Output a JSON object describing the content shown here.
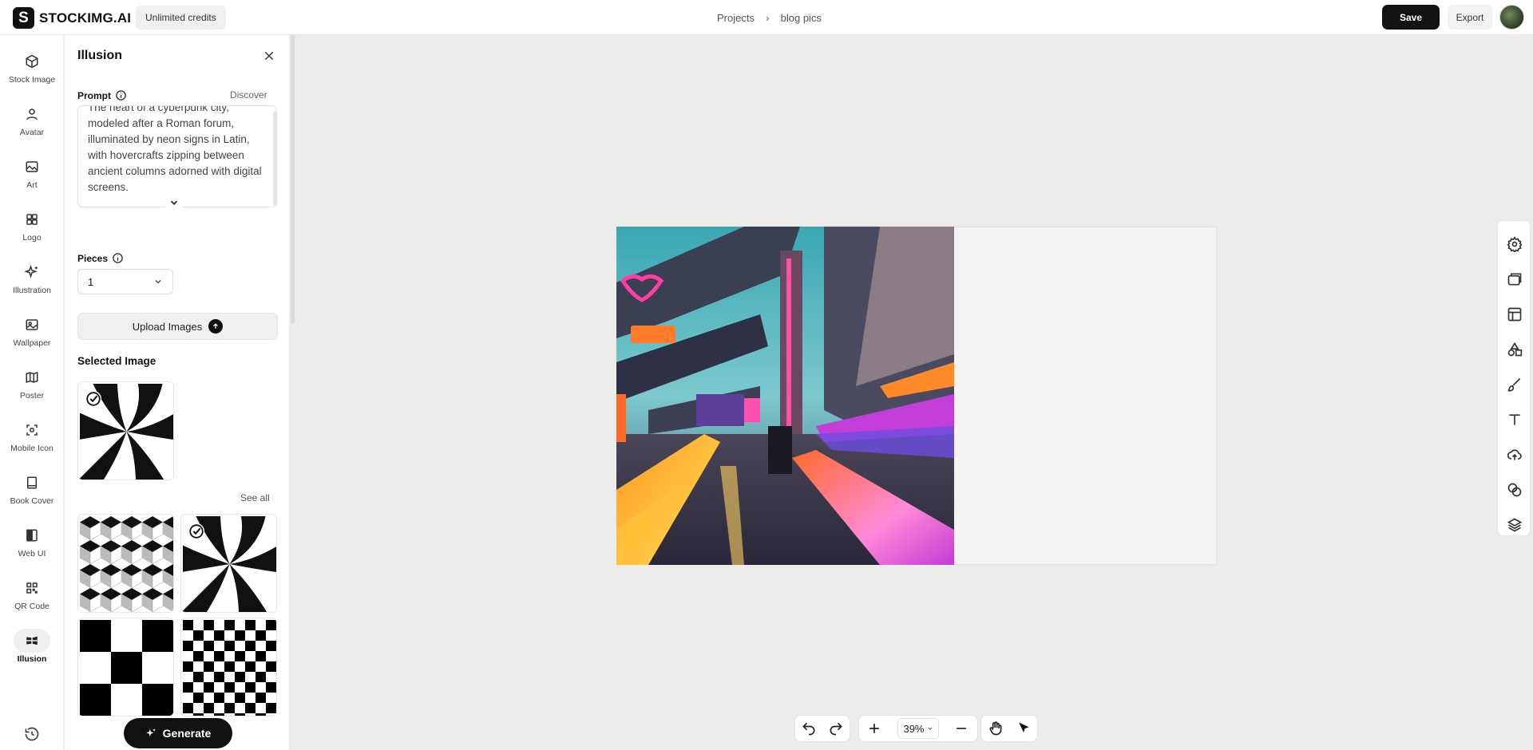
{
  "header": {
    "brand": "STOCKIMG.AI",
    "logo_letter": "S",
    "credits_label": "Unlimited credits",
    "breadcrumb": [
      "Projects",
      "blog pics"
    ],
    "save_label": "Save",
    "export_label": "Export"
  },
  "rail": {
    "items": [
      {
        "label": "Stock Image",
        "icon": "cube-icon"
      },
      {
        "label": "Avatar",
        "icon": "person-icon"
      },
      {
        "label": "Art",
        "icon": "image-icon"
      },
      {
        "label": "Logo",
        "icon": "grid-icon"
      },
      {
        "label": "Illustration",
        "icon": "sparkle-icon"
      },
      {
        "label": "Wallpaper",
        "icon": "picture-icon"
      },
      {
        "label": "Poster",
        "icon": "map-icon"
      },
      {
        "label": "Mobile Icon",
        "icon": "focus-icon"
      },
      {
        "label": "Book Cover",
        "icon": "book-icon"
      },
      {
        "label": "Web UI",
        "icon": "layout-icon"
      },
      {
        "label": "QR Code",
        "icon": "qr-icon"
      },
      {
        "label": "Illusion",
        "icon": "illusion-icon",
        "active": true
      }
    ]
  },
  "panel": {
    "title": "Illusion",
    "prompt_label": "Prompt",
    "discover_label": "Discover",
    "prompt_text": "The heart of a cyberpunk city, modeled after a Roman forum, illuminated by neon signs in Latin, with hovercrafts zipping between ancient columns adorned with digital screens.",
    "pieces_label": "Pieces",
    "pieces_value": "1",
    "upload_label": "Upload Images",
    "selected_image_label": "Selected Image",
    "see_all_label": "See all",
    "generate_label": "Generate",
    "patterns": [
      "swirl",
      "cubes",
      "swirl",
      "checker-large",
      "checker-small"
    ]
  },
  "canvas": {
    "zoom": "39%"
  },
  "right_toolbar": [
    "settings-icon",
    "folder-icon",
    "template-icon",
    "shapes-icon",
    "brush-icon",
    "text-icon",
    "upload-cloud-icon",
    "effects-icon",
    "layers-icon"
  ],
  "colors": {
    "accent": "#111111",
    "canvas_bg": "#ececea"
  }
}
